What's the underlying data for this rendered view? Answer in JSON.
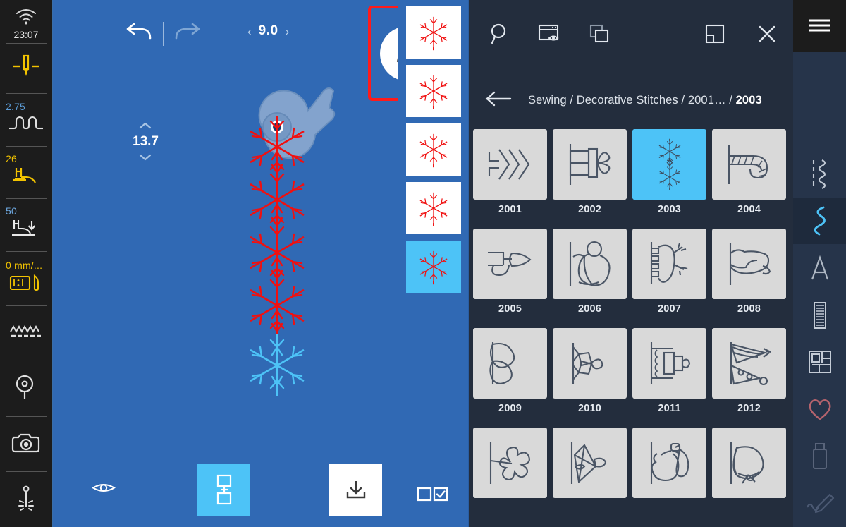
{
  "left_rail": {
    "wifi_icon": "wifi-icon",
    "time": "23:07",
    "items": [
      {
        "name": "needle-stop-position",
        "value": "",
        "icon": "needle-down-icon",
        "value_color": ""
      },
      {
        "name": "stitch-width",
        "value": "2.75",
        "icon": "stitch-width-icon",
        "value_color": "#5b9bd5"
      },
      {
        "name": "presser-foot-pressure",
        "value": "26",
        "icon": "presser-foot-icon",
        "value_color": "#f2c300"
      },
      {
        "name": "presser-foot-lift-height",
        "value": "50",
        "icon": "presser-foot-lift-icon",
        "value_color": "#6ea8e0"
      },
      {
        "name": "speed",
        "value": "0 mm/...",
        "icon": "speed-control-icon",
        "value_color": "#f2c300"
      },
      {
        "name": "feed-dog",
        "value": "",
        "icon": "feed-dog-icon",
        "value_color": ""
      },
      {
        "name": "bobbin-thread",
        "value": "",
        "icon": "bobbin-icon",
        "value_color": ""
      },
      {
        "name": "camera",
        "value": "",
        "icon": "camera-icon",
        "value_color": ""
      },
      {
        "name": "needle-light",
        "value": "",
        "icon": "needle-light-icon",
        "value_color": ""
      }
    ]
  },
  "canvas": {
    "undo_label": "undo-icon",
    "redo_label": "redo-icon",
    "stitch_width_value": "9.0",
    "stitch_width_prev": "‹",
    "stitch_width_next": "›",
    "stitch_length_value": "13.7",
    "stitch_length_up": "⌃",
    "stitch_length_down": "⌄",
    "edit_button": "pencil-icon",
    "edit_button_highlight_color": "#ff1a1a",
    "preview_button": "eye-icon",
    "combine_button": "combine-patterns-icon",
    "save_button": "save-download-icon",
    "accent_color": "#4dc3f7",
    "background_color": "#3069b4",
    "stitch_color_sewn": "#f01010",
    "stitch_color_active": "#4dc3f7"
  },
  "sequence": {
    "items": [
      {
        "label": "snowflake-stitch-1",
        "selected": false
      },
      {
        "label": "snowflake-stitch-2",
        "selected": false
      },
      {
        "label": "snowflake-stitch-3",
        "selected": false
      },
      {
        "label": "snowflake-stitch-4",
        "selected": false
      },
      {
        "label": "snowflake-stitch-5",
        "selected": true
      }
    ],
    "multi_select_button": "multi-select-icon"
  },
  "panel": {
    "tools": [
      {
        "name": "search-icon",
        "label": "search"
      },
      {
        "name": "preview-window-icon",
        "label": "preview"
      },
      {
        "name": "duplicate-icon",
        "label": "duplicate"
      }
    ],
    "tools_right": [
      {
        "name": "resize-panel-icon",
        "label": "resize"
      },
      {
        "name": "close-icon",
        "label": "close"
      }
    ],
    "back_icon": "back-arrow-icon",
    "breadcrumb_prefix": "Sewing / Decorative Stitches / 2001… / ",
    "breadcrumb_current": "2003",
    "selected_color": "#4dc3f7",
    "tiles": [
      {
        "id": "2001",
        "label": "2001",
        "icon": "zigzag-arrow-stitch",
        "selected": false
      },
      {
        "id": "2002",
        "label": "2002",
        "icon": "gift-bow-stitch",
        "selected": false
      },
      {
        "id": "2003",
        "label": "2003",
        "icon": "snowflake-stitch",
        "selected": true
      },
      {
        "id": "2004",
        "label": "2004",
        "icon": "candy-cane-stitch",
        "selected": false
      },
      {
        "id": "2005",
        "label": "2005",
        "icon": "arrow-leaf-stitch",
        "selected": false
      },
      {
        "id": "2006",
        "label": "2006",
        "icon": "snowman-stitch",
        "selected": false
      },
      {
        "id": "2007",
        "label": "2007",
        "icon": "mitten-stitch",
        "selected": false
      },
      {
        "id": "2008",
        "label": "2008",
        "icon": "sock-stitch",
        "selected": false
      },
      {
        "id": "2009",
        "label": "2009",
        "icon": "double-heart-stitch",
        "selected": false
      },
      {
        "id": "2010",
        "label": "2010",
        "icon": "candy-stitch",
        "selected": false
      },
      {
        "id": "2011",
        "label": "2011",
        "icon": "cake-stitch",
        "selected": false
      },
      {
        "id": "2012",
        "label": "2012",
        "icon": "party-hat-stitch",
        "selected": false
      },
      {
        "id": "2013",
        "label": "",
        "icon": "clover-stitch",
        "selected": false
      },
      {
        "id": "2014",
        "label": "",
        "icon": "kite-stitch",
        "selected": false
      },
      {
        "id": "2015",
        "label": "",
        "icon": "bunny-stitch",
        "selected": false
      },
      {
        "id": "2016",
        "label": "",
        "icon": "bonnet-stitch",
        "selected": false
      }
    ]
  },
  "right_rail": {
    "menu_icon": "hamburger-menu-icon",
    "items": [
      {
        "name": "utility-stitches-icon",
        "active": false
      },
      {
        "name": "decorative-stitches-icon",
        "active": true
      },
      {
        "name": "alphabet-icon",
        "active": false
      },
      {
        "name": "buttonhole-icon",
        "active": false
      },
      {
        "name": "quilting-icon",
        "active": false
      },
      {
        "name": "favorites-icon",
        "active": false
      },
      {
        "name": "usb-stick-icon",
        "active": false
      },
      {
        "name": "custom-stitch-icon",
        "active": false
      }
    ]
  }
}
